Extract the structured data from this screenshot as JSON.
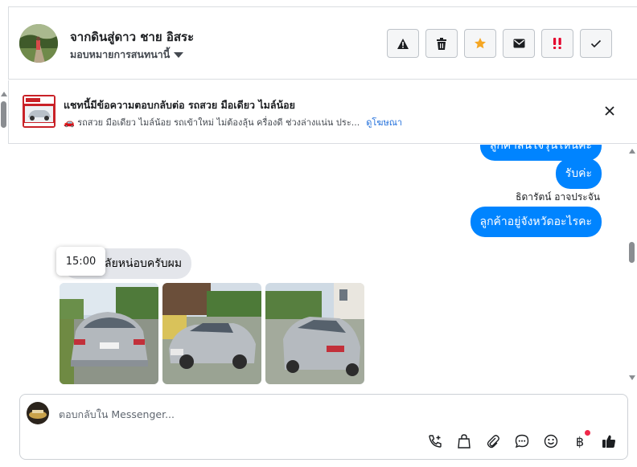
{
  "header": {
    "contact_name": "จากดินสู่ดาว ชาย อิสระ",
    "assign_label": "มอบหมายการสนทนานี้",
    "actions": [
      {
        "name": "report-spam-button",
        "icon": "warning-triangle-icon",
        "color": "#1c1e21"
      },
      {
        "name": "delete-button",
        "icon": "trash-icon",
        "color": "#1c1e21"
      },
      {
        "name": "star-button",
        "icon": "star-icon",
        "color": "#f5a623"
      },
      {
        "name": "mark-unread-button",
        "icon": "envelope-icon",
        "color": "#1c1e21"
      },
      {
        "name": "follow-up-button",
        "icon": "double-exclamation-icon",
        "color": "#e4002b"
      },
      {
        "name": "mark-done-button",
        "icon": "checkmark-icon",
        "color": "#1c1e21"
      }
    ]
  },
  "ad_banner": {
    "title": "แชทนี้มีข้อความตอบกลับต่อ รถสวย มือเดียว ไมล์น้อย",
    "description": "🚗 รถสวย มือเดียว ไมล์น้อย รถเข้าใหม่ ไม่ต้องลุ้น ครื่องดี ช่วงล่างแน่น ประ...",
    "link_label": "ดูโฆษณา"
  },
  "messages": {
    "outgoing_top_partial": "ลูกค้าสนใจรุ่นไหนคะ",
    "outgoing_1": "รับค่ะ",
    "sender_name": "ธิดารัตน์ อาจประจัน",
    "outgoing_2": "ลูกค้าอยู่จังหวัดอะไรคะ",
    "incoming_1": "ลัยหน่อบครับผม",
    "tooltip_time": "15:00"
  },
  "composer": {
    "placeholder": "ตอบกลับใน Messenger...",
    "tools": [
      "call-add-icon",
      "shopping-bag-icon",
      "paperclip-icon",
      "chat-bubble-icon",
      "smiley-icon",
      "baht-icon",
      "thumbs-up-icon"
    ],
    "baht_symbol": "฿"
  },
  "colors": {
    "accent": "#0084ff",
    "incoming_bubble": "#e4e6eb",
    "link": "#216fdb"
  }
}
